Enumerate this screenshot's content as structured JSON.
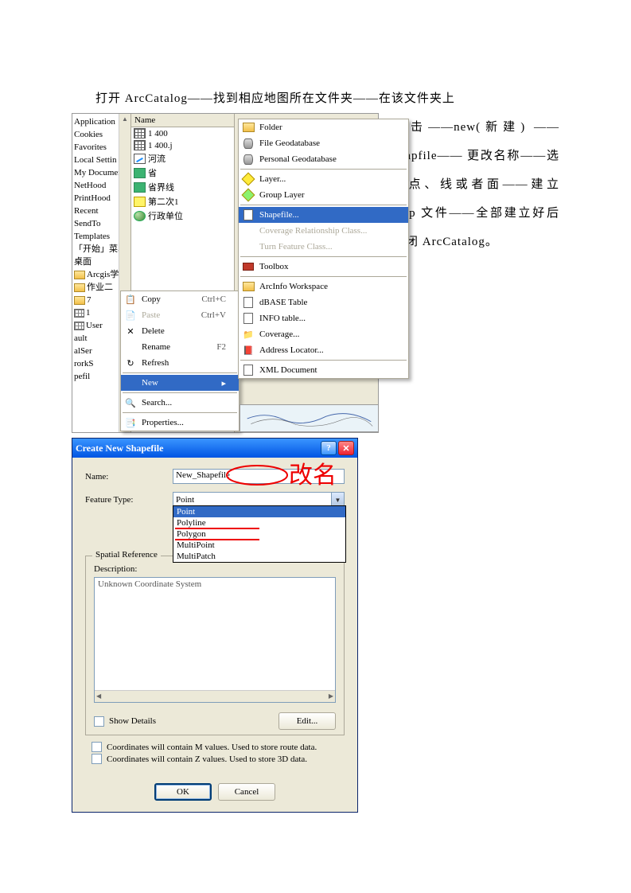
{
  "intro": "打开 ArcCatalog——找到相应地图所在文件夹——在该文件夹上",
  "side_text": "右击——new(新建) ——shapfile—— 更改名称——选择点、线或者面——建立 .shp 文件——全部建立好后关闭 ArcCatalog。",
  "tree_items": [
    "Application",
    "Cookies",
    "Favorites",
    "Local Settin",
    "My Documents",
    "NetHood",
    "PrintHood",
    "Recent",
    "SendTo",
    "Templates",
    "「开始」菜单",
    "桌面",
    "Arcgis学习",
    "作业二",
    "7",
    "1",
    "User",
    "ault",
    "alSer",
    "rorkS",
    "pefil"
  ],
  "catalog_header": "Name",
  "catalog_items": [
    {
      "icon": "grid",
      "label": "1  400"
    },
    {
      "icon": "grid",
      "label": "1  400.j"
    },
    {
      "icon": "line",
      "label": "河流"
    },
    {
      "icon": "green",
      "label": "省"
    },
    {
      "icon": "green",
      "label": "省界线"
    },
    {
      "icon": "yellow",
      "label": "第二次1"
    },
    {
      "icon": "globe",
      "label": "行政单位"
    }
  ],
  "ctx1": {
    "copy": "Copy",
    "copy_key": "Ctrl+C",
    "paste": "Paste",
    "paste_key": "Ctrl+V",
    "delete": "Delete",
    "rename": "Rename",
    "rename_key": "F2",
    "refresh": "Refresh",
    "new": "New",
    "search": "Search...",
    "properties": "Properties..."
  },
  "ctx2": {
    "folder": "Folder",
    "filegdb": "File Geodatabase",
    "personalgdb": "Personal Geodatabase",
    "layer": "Layer...",
    "grouplayer": "Group Layer",
    "shapefile": "Shapefile...",
    "covrel": "Coverage Relationship Class...",
    "turnfc": "Turn Feature Class...",
    "toolbox": "Toolbox",
    "arcinfo": "ArcInfo Workspace",
    "dbase": "dBASE Table",
    "info": "INFO table...",
    "coverage": "Coverage...",
    "address": "Address Locator...",
    "xml": "XML Document"
  },
  "dialog": {
    "title": "Create New Shapefile",
    "name_label": "Name:",
    "name_value": "New_Shapefile",
    "feature_label": "Feature Type:",
    "feature_value": "Point",
    "options": [
      "Point",
      "Polyline",
      "Polygon",
      "MultiPoint",
      "MultiPatch"
    ],
    "spatial_ref": "Spatial Reference",
    "description": "Description:",
    "desc_text": "Unknown Coordinate System",
    "show_details": "Show Details",
    "edit": "Edit...",
    "m_values": "Coordinates will contain M values. Used to store route data.",
    "z_values": "Coordinates will contain Z values. Used to store 3D data.",
    "ok": "OK",
    "cancel": "Cancel"
  },
  "annotation": "改名"
}
